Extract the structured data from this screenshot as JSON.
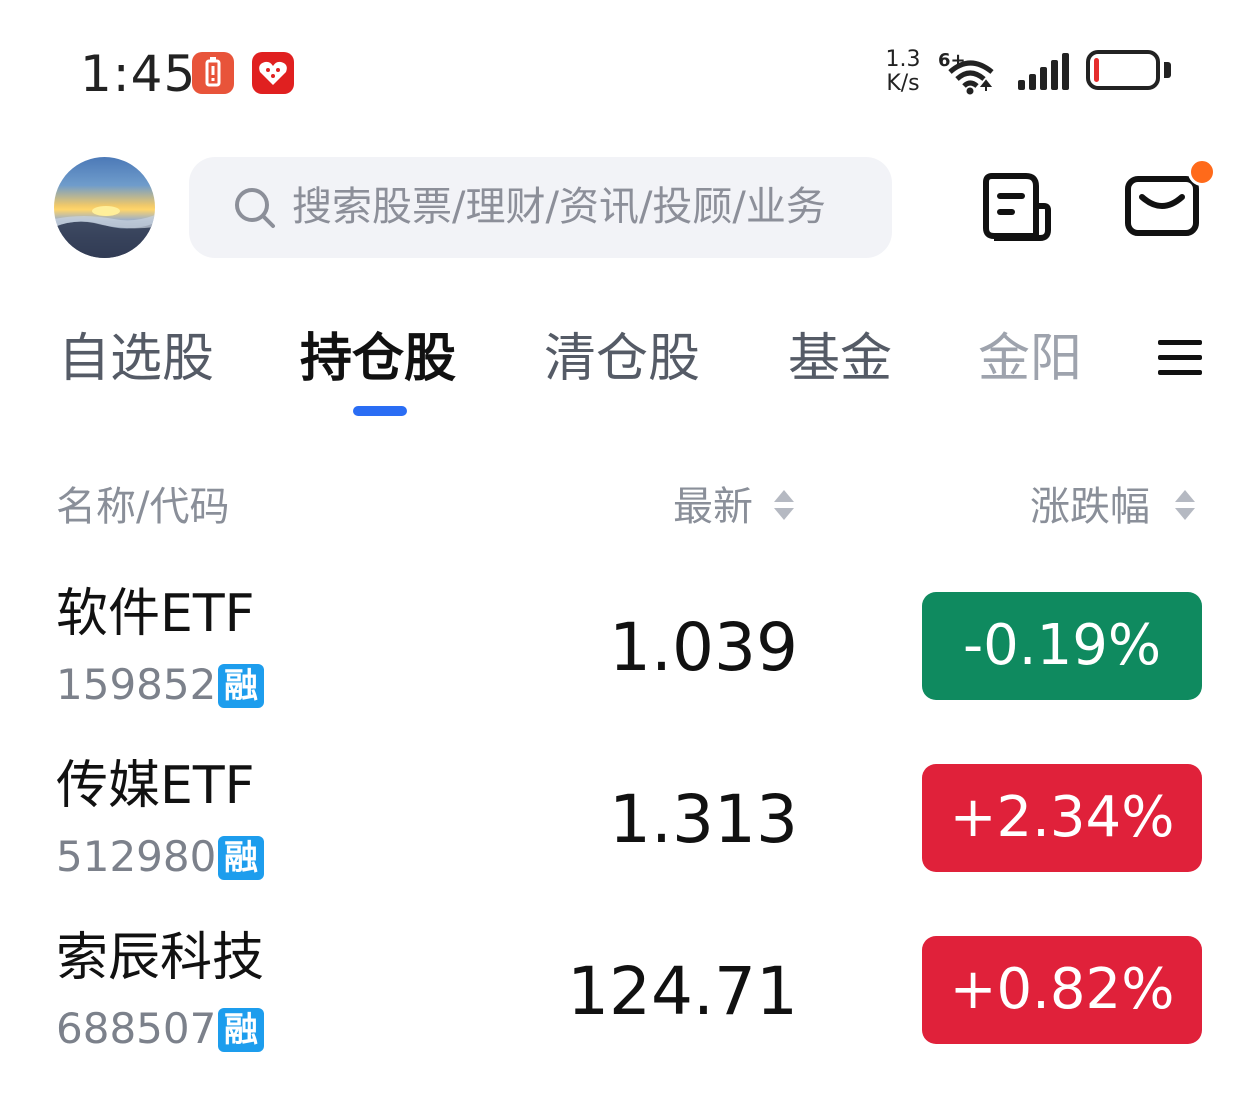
{
  "status_bar": {
    "time": "1:45",
    "net_speed_value": "1.3",
    "net_speed_unit": "K/s",
    "network_type": "6+",
    "battery_level": 0.08
  },
  "header": {
    "search_placeholder": "搜索股票/理财/资讯/投顾/业务",
    "mail_has_notification": true
  },
  "tabs": [
    {
      "label": "自选股",
      "active": false
    },
    {
      "label": "持仓股",
      "active": true
    },
    {
      "label": "清仓股",
      "active": false
    },
    {
      "label": "基金",
      "active": false
    },
    {
      "label": "金阳",
      "active": false
    }
  ],
  "columns": {
    "name_code": "名称/代码",
    "latest": "最新",
    "change_pct": "涨跌幅"
  },
  "margin_badge": "融",
  "stocks": [
    {
      "name": "软件ETF",
      "code": "159852",
      "price": "1.039",
      "change": "-0.19%",
      "color": "#0f8a5f"
    },
    {
      "name": "传媒ETF",
      "code": "512980",
      "price": "1.313",
      "change": "+2.34%",
      "color": "#e0213a"
    },
    {
      "name": "索辰科技",
      "code": "688507",
      "price": "124.71",
      "change": "+0.82%",
      "color": "#e0213a"
    }
  ],
  "colors": {
    "accent": "#2a6df4",
    "up": "#e0213a",
    "down": "#0f8a5f",
    "badge": "#1d9ded",
    "notification_dot": "#ff6a1a"
  }
}
